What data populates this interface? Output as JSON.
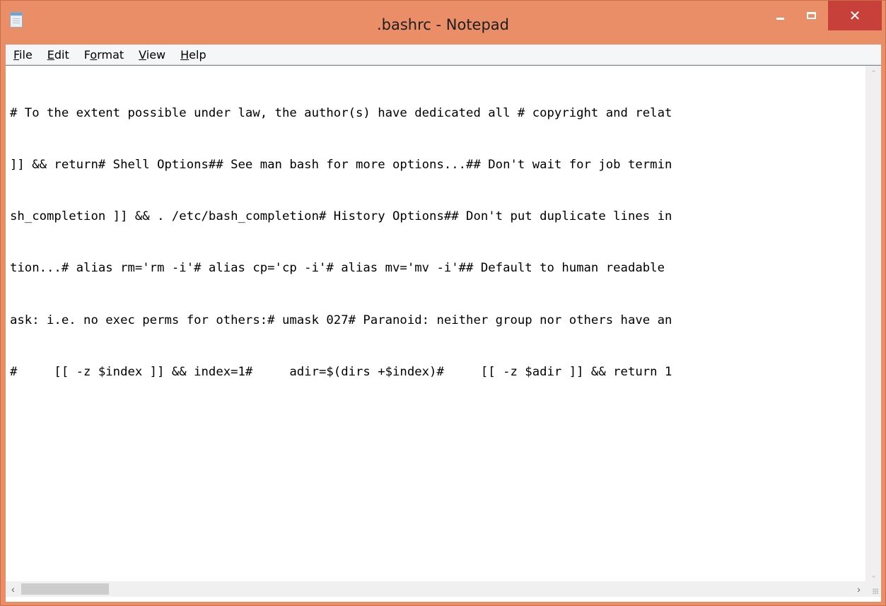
{
  "window": {
    "title": ".bashrc - Notepad",
    "icon": "notepad-icon",
    "controls": {
      "minimize_icon": "minimize-icon",
      "maximize_icon": "maximize-icon",
      "close_label": "✕"
    },
    "colors": {
      "frame": "#ea8e67",
      "close_button": "#c7413a"
    }
  },
  "menu": {
    "file": {
      "key": "F",
      "rest": "ile"
    },
    "edit": {
      "key": "E",
      "rest": "dit"
    },
    "format": {
      "pre": "F",
      "key": "o",
      "rest": "rmat"
    },
    "view": {
      "key": "V",
      "rest": "iew"
    },
    "help": {
      "key": "H",
      "rest": "elp"
    }
  },
  "editor": {
    "lines": [
      "# To the extent possible under law, the author(s) have dedicated all # copyright and relat",
      "]] && return# Shell Options## See man bash for more options...## Don't wait for job termin",
      "sh_completion ]] && . /etc/bash_completion# History Options## Don't put duplicate lines in",
      "tion...# alias rm='rm -i'# alias cp='cp -i'# alias mv='mv -i'## Default to human readable",
      "ask: i.e. no exec perms for others:# umask 027# Paranoid: neither group nor others have an",
      "#     [[ -z $index ]] && index=1#     adir=$(dirs +$index)#     [[ -z $adir ]] && return 1"
    ]
  },
  "scrollbars": {
    "up_arrow": "⌃",
    "down_arrow": "⌄",
    "left_arrow": "‹",
    "right_arrow": "›"
  }
}
